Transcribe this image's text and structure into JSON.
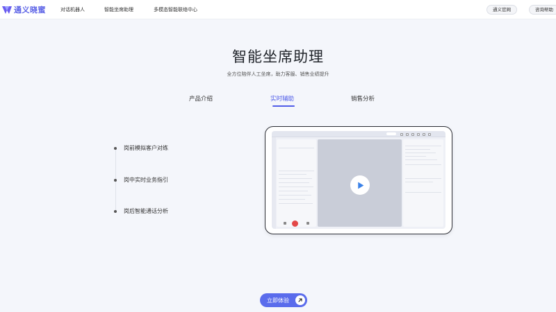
{
  "brand": {
    "name": "通义晓蜜"
  },
  "nav": {
    "items": [
      {
        "label": "对话机器人"
      },
      {
        "label": "智能坐席助理"
      },
      {
        "label": "多模态智能联络中心"
      }
    ],
    "buttons": [
      {
        "label": "通义官网"
      },
      {
        "label": "咨询帮助"
      }
    ]
  },
  "hero": {
    "title": "智能坐席助理",
    "subtitle": "全方位陪伴人工坐席，助力客服、销售业绩提升"
  },
  "tabs": [
    {
      "label": "产品介绍",
      "active": false
    },
    {
      "label": "实时辅助",
      "active": true
    },
    {
      "label": "销售分析",
      "active": false
    }
  ],
  "features": [
    {
      "label": "岗前模拟客户对练"
    },
    {
      "label": "岗中实时业务指引"
    },
    {
      "label": "岗后智能通话分析"
    }
  ],
  "cta": {
    "label": "立即体验"
  },
  "colors": {
    "accent": "#4f5ce8",
    "cta": "#5a6cec",
    "background": "#f4f6fb"
  }
}
